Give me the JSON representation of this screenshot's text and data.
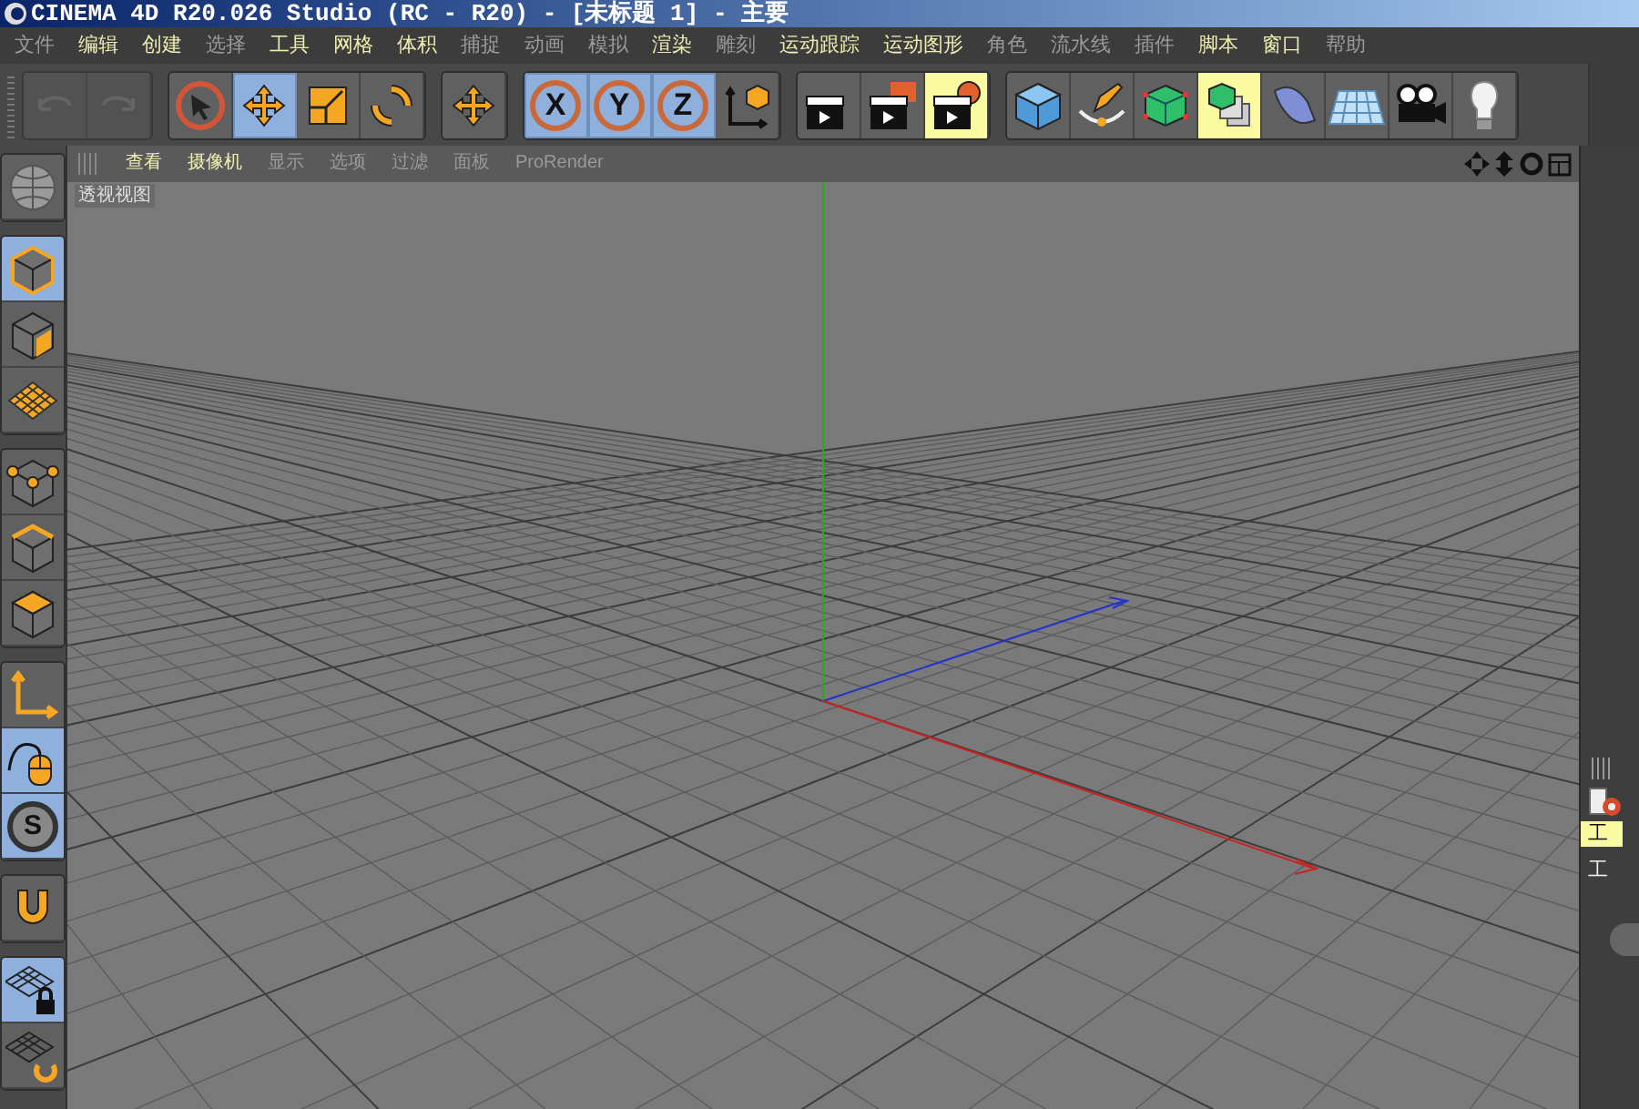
{
  "window": {
    "title": "CINEMA 4D R20.026 Studio (RC - R20) - [未标题 1] - 主要"
  },
  "menu": [
    {
      "label": "文件",
      "highlighted": false
    },
    {
      "label": "编辑",
      "highlighted": true
    },
    {
      "label": "创建",
      "highlighted": true
    },
    {
      "label": "选择",
      "highlighted": false
    },
    {
      "label": "工具",
      "highlighted": true
    },
    {
      "label": "网格",
      "highlighted": true
    },
    {
      "label": "体积",
      "highlighted": true
    },
    {
      "label": "捕捉",
      "highlighted": false
    },
    {
      "label": "动画",
      "highlighted": false
    },
    {
      "label": "模拟",
      "highlighted": false
    },
    {
      "label": "渲染",
      "highlighted": true
    },
    {
      "label": "雕刻",
      "highlighted": false
    },
    {
      "label": "运动跟踪",
      "highlighted": true
    },
    {
      "label": "运动图形",
      "highlighted": true
    },
    {
      "label": "角色",
      "highlighted": false
    },
    {
      "label": "流水线",
      "highlighted": false
    },
    {
      "label": "插件",
      "highlighted": false
    },
    {
      "label": "脚本",
      "highlighted": true
    },
    {
      "label": "窗口",
      "highlighted": true
    },
    {
      "label": "帮助",
      "highlighted": false
    }
  ],
  "toolbar": [
    {
      "disabled": true,
      "buttons": [
        {
          "kind": "undo",
          "selected": false,
          "highlighted": false
        },
        {
          "kind": "redo",
          "selected": false,
          "highlighted": false
        }
      ]
    },
    {
      "disabled": false,
      "buttons": [
        {
          "kind": "select",
          "selected": false,
          "highlighted": false
        },
        {
          "kind": "move",
          "selected": true,
          "highlighted": false
        },
        {
          "kind": "scale",
          "selected": false,
          "highlighted": false
        },
        {
          "kind": "rotate",
          "selected": false,
          "highlighted": false
        }
      ]
    },
    {
      "disabled": false,
      "buttons": [
        {
          "kind": "move",
          "selected": false,
          "highlighted": false
        }
      ]
    },
    {
      "disabled": false,
      "buttons": [
        {
          "kind": "axis",
          "label": "X",
          "selected": true,
          "highlighted": false
        },
        {
          "kind": "axis",
          "label": "Y",
          "selected": true,
          "highlighted": false
        },
        {
          "kind": "axis",
          "label": "Z",
          "selected": true,
          "highlighted": false
        },
        {
          "kind": "coords",
          "selected": false,
          "highlighted": false
        }
      ]
    },
    {
      "disabled": false,
      "buttons": [
        {
          "kind": "render_view",
          "selected": false,
          "highlighted": false
        },
        {
          "kind": "render_picture",
          "selected": false,
          "highlighted": false
        },
        {
          "kind": "render_settings",
          "selected": false,
          "highlighted": true
        }
      ]
    },
    {
      "disabled": false,
      "buttons": [
        {
          "kind": "cube",
          "selected": false,
          "highlighted": false
        },
        {
          "kind": "pen",
          "selected": false,
          "highlighted": false
        },
        {
          "kind": "subdivision",
          "selected": false,
          "highlighted": false
        },
        {
          "kind": "cloner",
          "selected": false,
          "highlighted": true
        },
        {
          "kind": "deformer",
          "selected": false,
          "highlighted": false
        },
        {
          "kind": "floor",
          "selected": false,
          "highlighted": false
        },
        {
          "kind": "camera",
          "selected": false,
          "highlighted": false
        },
        {
          "kind": "light",
          "selected": false,
          "highlighted": false
        }
      ]
    }
  ],
  "side_toolbar": [
    [
      {
        "kind": "viewport",
        "selected": false
      }
    ],
    [
      {
        "kind": "model",
        "selected": true
      },
      {
        "kind": "texture",
        "selected": false
      },
      {
        "kind": "workplane",
        "selected": false
      }
    ],
    [
      {
        "kind": "points",
        "selected": false
      },
      {
        "kind": "edges",
        "selected": false
      },
      {
        "kind": "polygons",
        "selected": false
      }
    ],
    [
      {
        "kind": "axis_mode",
        "selected": false
      },
      {
        "kind": "tweak",
        "selected": true
      },
      {
        "kind": "snap",
        "label": "S",
        "selected": true
      }
    ],
    [
      {
        "kind": "magnet",
        "selected": false
      }
    ],
    [
      {
        "kind": "grid_lock",
        "selected": true
      },
      {
        "kind": "grid_rotate",
        "selected": false
      }
    ]
  ],
  "viewport": {
    "menu": [
      {
        "label": "查看",
        "highlighted": true
      },
      {
        "label": "摄像机",
        "highlighted": true
      },
      {
        "label": "显示",
        "highlighted": false
      },
      {
        "label": "选项",
        "highlighted": false
      },
      {
        "label": "过滤",
        "highlighted": false
      },
      {
        "label": "面板",
        "highlighted": false
      },
      {
        "label": "ProRender",
        "highlighted": false
      }
    ],
    "label": "透视视图"
  },
  "right_panel": {
    "tabs": [
      {
        "label": "工",
        "selected": true
      },
      {
        "label": "工",
        "selected": false
      }
    ]
  }
}
